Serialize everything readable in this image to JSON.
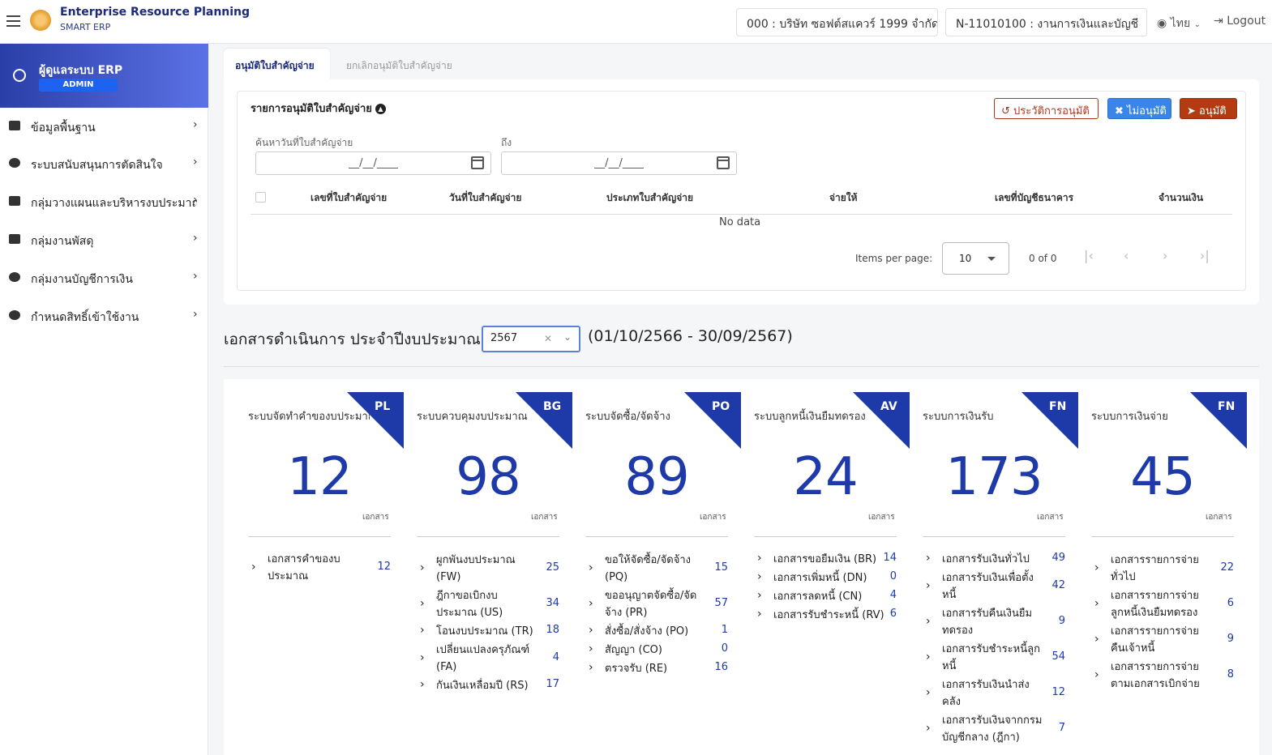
{
  "header": {
    "app_title": "Enterprise Resource Planning",
    "app_subtitle": "SMART ERP",
    "company": "000 : บริษัท ซอฟต์สแควร์ 1999 จำกัด",
    "department": "N-11010100 : งานการเงินและบัญชี",
    "language": "ไทย",
    "logout": "Logout"
  },
  "sidebar": {
    "user_name": "ผู้ดูแลระบบ ERP",
    "user_role": "ADMIN",
    "items": [
      {
        "label": "ข้อมูลพื้นฐาน"
      },
      {
        "label": "ระบบสนับสนุนการตัดสินใจ"
      },
      {
        "label": "กลุ่มวางแผนและบริหารงบประมาณ"
      },
      {
        "label": "กลุ่มงานพัสดุ"
      },
      {
        "label": "กลุ่มงานบัญชีการเงิน"
      },
      {
        "label": "กำหนดสิทธิ์เข้าใช้งาน"
      }
    ]
  },
  "tabs": [
    {
      "label": "อนุมัติใบสำคัญจ่าย"
    },
    {
      "label": "ยกเลิกอนุมัติใบสำคัญจ่าย"
    }
  ],
  "panel": {
    "title": "รายการอนุมัติใบสำคัญจ่าย",
    "history_button": "ประวัติการอนุมัติ",
    "reject_button": "ไม่อนุมัติ",
    "approve_button": "อนุมัติ",
    "search_label": "ค้นหาวันที่ใบสำคัญจ่าย",
    "to_label": "ถึง",
    "date_from": "__/__/____",
    "date_to": "__/__/____",
    "columns": [
      "เลขที่ใบสำคัญจ่าย",
      "วันที่ใบสำคัญจ่าย",
      "ประเภทใบสำคัญจ่าย",
      "จ่ายให้",
      "เลขที่บัญชีธนาคาร",
      "จำนวนเงิน"
    ],
    "no_data": "No data",
    "items_per_page_label": "Items per page:",
    "items_per_page": "10",
    "range": "0 of 0"
  },
  "fiscal": {
    "title": "เอกสารดำเนินการ ประจำปีงบประมาณ",
    "year": "2567",
    "range": "(01/10/2566 - 30/09/2567)"
  },
  "cards": [
    {
      "title": "ระบบจัดทำคำของบประมาณ",
      "code": "PL",
      "total": "12",
      "unit": "เอกสาร",
      "items": [
        {
          "label": "เอกสารคำของบประมาณ",
          "count": "12"
        }
      ]
    },
    {
      "title": "ระบบควบคุมงบประมาณ",
      "code": "BG",
      "total": "98",
      "unit": "เอกสาร",
      "items": [
        {
          "label": "ผูกพันงบประมาณ (FW)",
          "count": "25"
        },
        {
          "label": "ฎีกาขอเบิกงบประมาณ (US)",
          "count": "34"
        },
        {
          "label": "โอนงบประมาณ (TR)",
          "count": "18"
        },
        {
          "label": "เปลี่ยนแปลงครุภัณฑ์ (FA)",
          "count": "4"
        },
        {
          "label": "กันเงินเหลื่อมปี (RS)",
          "count": "17"
        }
      ]
    },
    {
      "title": "ระบบจัดซื้อ/จัดจ้าง",
      "code": "PO",
      "total": "89",
      "unit": "เอกสาร",
      "items": [
        {
          "label": "ขอให้จัดซื้อ/จัดจ้าง (PQ)",
          "count": "15"
        },
        {
          "label": "ขออนุญาตจัดซื้อ/จัดจ้าง (PR)",
          "count": "57"
        },
        {
          "label": "สั่งซื้อ/สั่งจ้าง (PO)",
          "count": "1"
        },
        {
          "label": "สัญญา (CO)",
          "count": "0"
        },
        {
          "label": "ตรวจรับ (RE)",
          "count": "16"
        }
      ]
    },
    {
      "title": "ระบบลูกหนี้เงินยืมทดรอง",
      "code": "AV",
      "total": "24",
      "unit": "เอกสาร",
      "items": [
        {
          "label": "เอกสารขอยืมเงิน (BR)",
          "count": "14"
        },
        {
          "label": "เอกสารเพิ่มหนี้ (DN)",
          "count": "0"
        },
        {
          "label": "เอกสารลดหนี้ (CN)",
          "count": "4"
        },
        {
          "label": "เอกสารรับชำระหนี้ (RV)",
          "count": "6"
        }
      ]
    },
    {
      "title": "ระบบการเงินรับ",
      "code": "FN",
      "total": "173",
      "unit": "เอกสาร",
      "items": [
        {
          "label": "เอกสารรับเงินทั่วไป",
          "count": "49"
        },
        {
          "label": "เอกสารรับเงินเพื่อตั้งหนี้",
          "count": "42"
        },
        {
          "label": "เอกสารรับคืนเงินยืมทดรอง",
          "count": "9"
        },
        {
          "label": "เอกสารรับชำระหนี้ลูกหนี้",
          "count": "54"
        },
        {
          "label": "เอกสารรับเงินนำส่งคลัง",
          "count": "12"
        },
        {
          "label": "เอกสารรับเงินจากกรมบัญชีกลาง (ฎีกา)",
          "count": "7"
        }
      ]
    },
    {
      "title": "ระบบการเงินจ่าย",
      "code": "FN",
      "total": "45",
      "unit": "เอกสาร",
      "items": [
        {
          "label": "เอกสารรายการจ่ายทั่วไป",
          "count": "22"
        },
        {
          "label": "เอกสารรายการจ่ายลูกหนี้เงินยืมทดรอง",
          "count": "6"
        },
        {
          "label": "เอกสารรายการจ่ายคืนเจ้าหนี้",
          "count": "9"
        },
        {
          "label": "เอกสารรายการจ่ายตามเอกสารเบิกจ่าย",
          "count": "8"
        }
      ]
    }
  ]
}
